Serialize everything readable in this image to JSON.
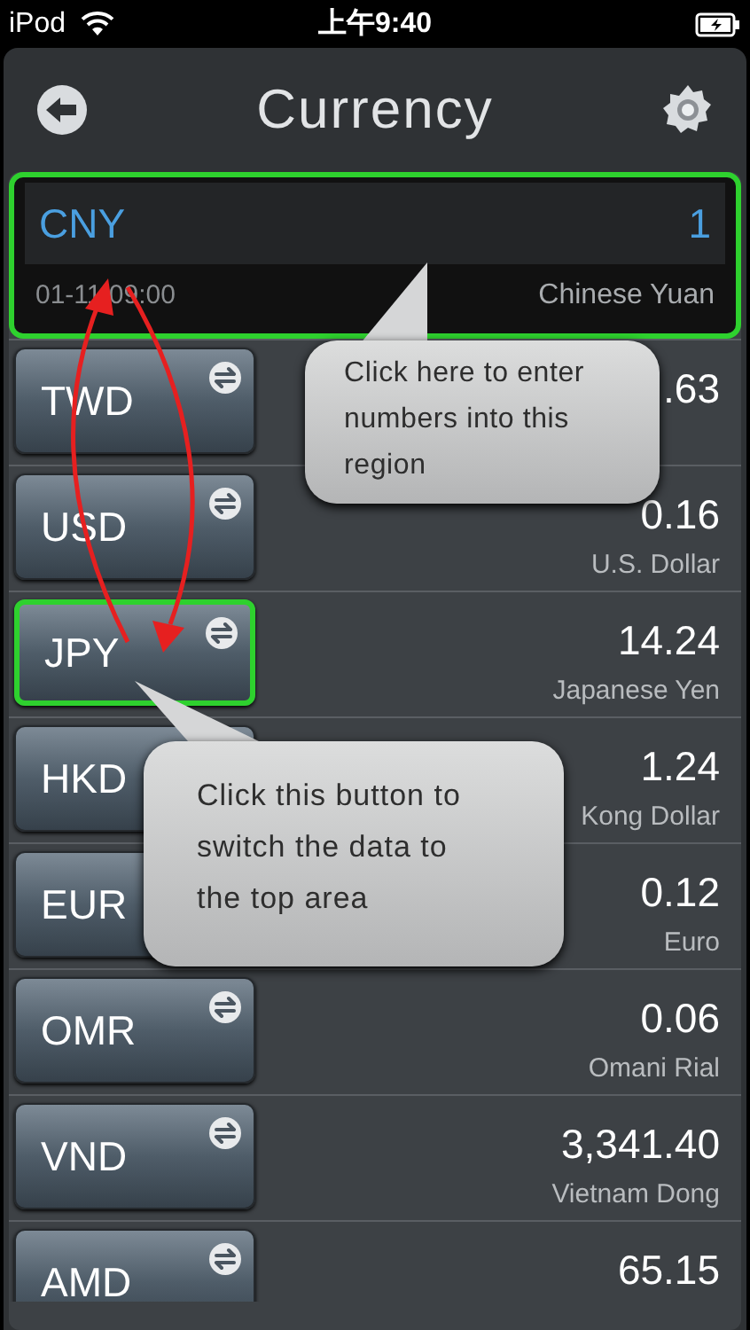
{
  "status_bar": {
    "carrier": "iPod",
    "time": "上午9:40"
  },
  "header": {
    "title": "Currency"
  },
  "top_area": {
    "code": "CNY",
    "value": "1",
    "date": "01-11 09:00",
    "name": "Chinese Yuan",
    "selected": true
  },
  "rows": [
    {
      "code": "TWD",
      "value": ".63",
      "selected": false,
      "swap_icon": true
    },
    {
      "code": "USD",
      "value": "0.16",
      "name": "U.S. Dollar",
      "selected": false,
      "swap_icon": true
    },
    {
      "code": "JPY",
      "value": "14.24",
      "name": "Japanese Yen",
      "selected": true,
      "swap_icon": true
    },
    {
      "code": "HKD",
      "value": "1.24",
      "name": "Kong Dollar",
      "selected": false,
      "swap_icon": false
    },
    {
      "code": "EUR",
      "value": "0.12",
      "name": "Euro",
      "selected": false,
      "swap_icon": false
    },
    {
      "code": "OMR",
      "value": "0.06",
      "name": "Omani Rial",
      "selected": false,
      "swap_icon": true
    },
    {
      "code": "VND",
      "value": "3,341.40",
      "name": "Vietnam Dong",
      "selected": false,
      "swap_icon": true
    },
    {
      "code": "AMD",
      "value": "65.15",
      "selected": false,
      "swap_icon": true
    }
  ],
  "callouts": [
    {
      "text": "Click here to enter numbers into this region"
    },
    {
      "text": "Click this button to switch the data to the top area"
    }
  ]
}
